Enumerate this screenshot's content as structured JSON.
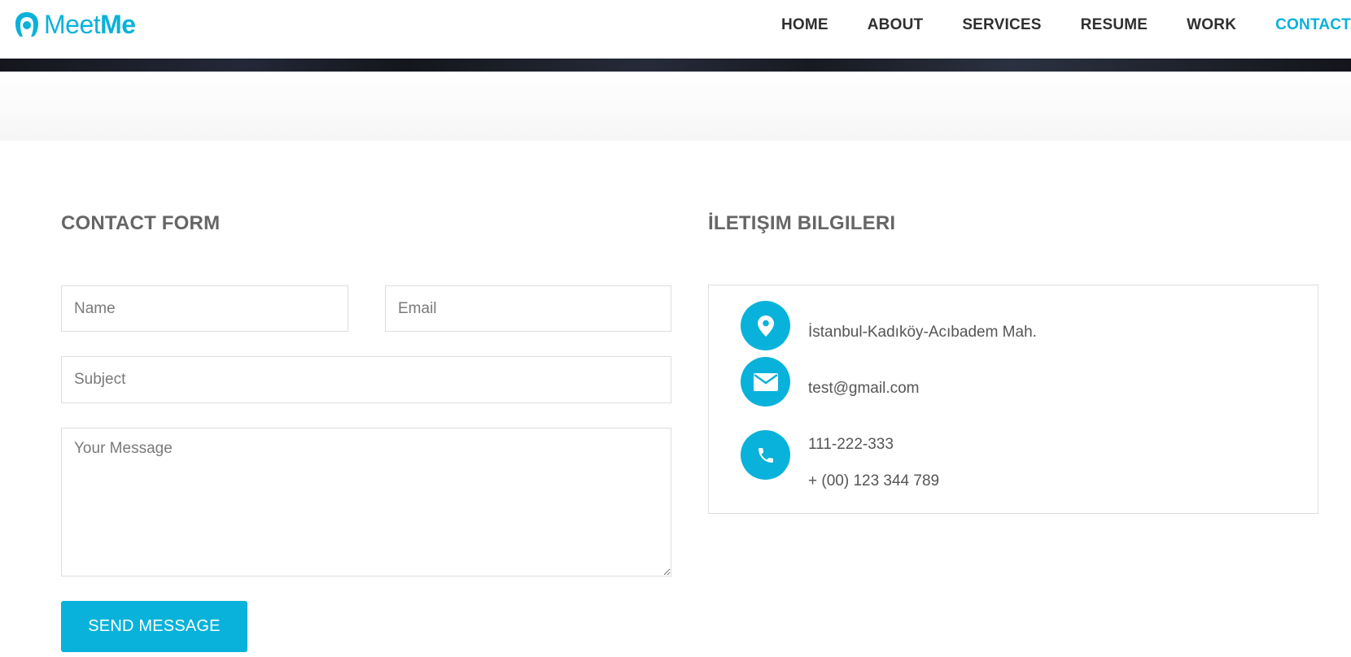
{
  "brand": {
    "logo_light": "Meet",
    "logo_bold": "Me",
    "accent_color": "#08b2da"
  },
  "nav": {
    "items": [
      "HOME",
      "ABOUT",
      "SERVICES",
      "RESUME",
      "WORK",
      "CONTACT"
    ],
    "active": "CONTACT"
  },
  "contact_form": {
    "title": "CONTACT FORM",
    "name_placeholder": "Name",
    "email_placeholder": "Email",
    "subject_placeholder": "Subject",
    "message_placeholder": "Your Message",
    "send_label": "SEND MESSAGE"
  },
  "contact_info": {
    "title": "İLETIŞIM BILGILERI",
    "address": "İstanbul-Kadıköy-Acıbadem Mah.",
    "email": "test@gmail.com",
    "phone_1": "111-222-333",
    "phone_2": "+ (00) 123 344 789",
    "icons": [
      "map-pin-icon",
      "envelope-icon",
      "phone-icon"
    ]
  }
}
